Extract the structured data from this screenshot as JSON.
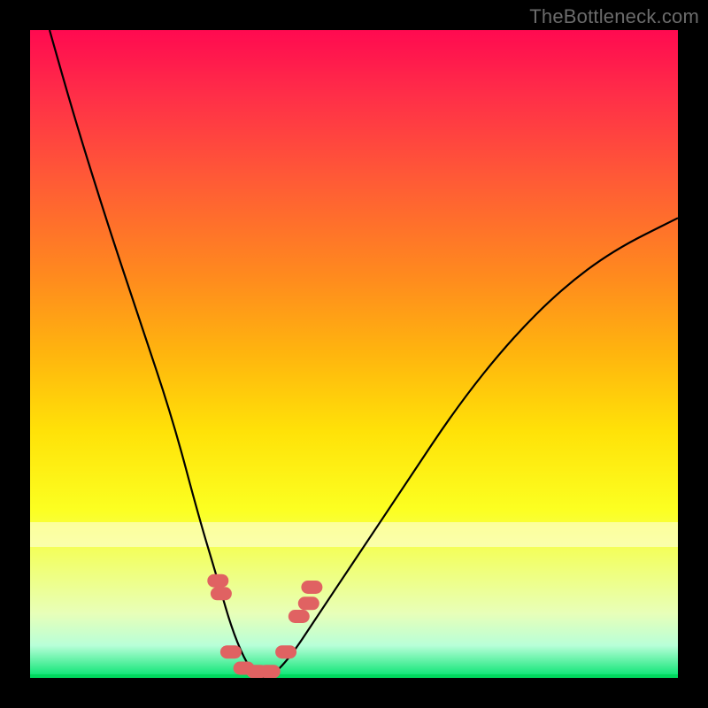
{
  "watermark": "TheBottleneck.com",
  "chart_data": {
    "type": "line",
    "title": "",
    "xlabel": "",
    "ylabel": "",
    "xlim": [
      0,
      100
    ],
    "ylim": [
      0,
      100
    ],
    "grid": false,
    "series": [
      {
        "name": "bottleneck-curve",
        "x": [
          3,
          7,
          12,
          17,
          22,
          26,
          29,
          31,
          33,
          35,
          37,
          40,
          44,
          50,
          58,
          66,
          74,
          82,
          90,
          100
        ],
        "y": [
          100,
          86,
          70,
          55,
          40,
          25,
          15,
          8,
          3,
          0,
          0,
          3,
          9,
          18,
          30,
          42,
          52,
          60,
          66,
          71
        ]
      }
    ],
    "markers": {
      "name": "highlight-points",
      "color": "#e06262",
      "x": [
        29.0,
        29.5,
        31.0,
        33.0,
        35.0,
        37.0,
        39.5,
        41.5,
        43.0,
        43.5
      ],
      "y": [
        15.0,
        13.0,
        4.0,
        1.5,
        1.0,
        1.0,
        4.0,
        9.5,
        11.5,
        14.0
      ]
    },
    "background_gradient": {
      "top": "#ff0a50",
      "mid": "#ffe208",
      "bottom": "#00e36e"
    }
  }
}
